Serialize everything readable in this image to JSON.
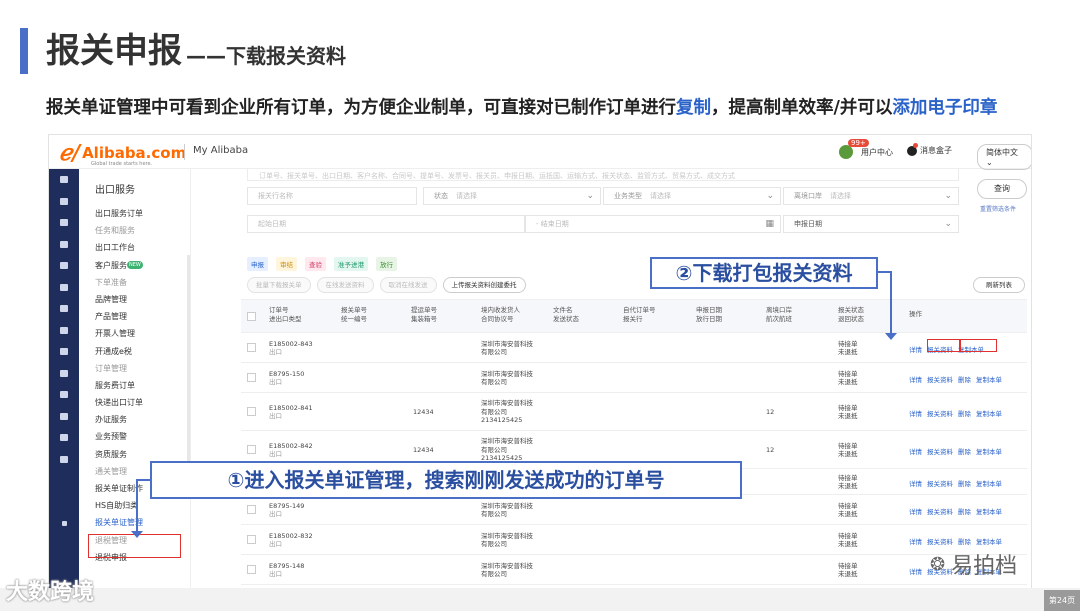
{
  "slide": {
    "title_main": "报关申报",
    "title_sub": "——下载报关资料",
    "subtitle_a": "报关单证管理中可看到企业所有订单，为方便企业制单，可直接对已制作订单进行",
    "subtitle_hl1": "复制",
    "subtitle_b": "，提高制单效率/并可以",
    "subtitle_hl2": "添加电子印章",
    "page_number": "第24页"
  },
  "header": {
    "brand": "Alibaba.com",
    "tagline": "Global trade starts here.",
    "portal": "My Alibaba",
    "user_center": "用户中心",
    "notify_badge": "99+",
    "message_box": "消息盒子",
    "language": "简体中文"
  },
  "sidebar": {
    "title": "出口服务",
    "items": [
      {
        "label": "出口服务订单",
        "kind": "item"
      },
      {
        "label": "任务和服务",
        "kind": "group"
      },
      {
        "label": "出口工作台",
        "kind": "item"
      },
      {
        "label": "客户服务",
        "kind": "item",
        "badge": "NEW"
      },
      {
        "label": "下单准备",
        "kind": "group"
      },
      {
        "label": "品牌管理",
        "kind": "item"
      },
      {
        "label": "产品管理",
        "kind": "item"
      },
      {
        "label": "开票人管理",
        "kind": "item"
      },
      {
        "label": "开通成e税",
        "kind": "item"
      },
      {
        "label": "订单管理",
        "kind": "group"
      },
      {
        "label": "服务费订单",
        "kind": "item"
      },
      {
        "label": "快递出口订单",
        "kind": "item"
      },
      {
        "label": "办证服务",
        "kind": "item"
      },
      {
        "label": "业务预警",
        "kind": "item"
      },
      {
        "label": "资质服务",
        "kind": "item"
      },
      {
        "label": "通关管理",
        "kind": "group"
      },
      {
        "label": "报关单证制作",
        "kind": "item"
      },
      {
        "label": "HS自助归类",
        "kind": "item"
      },
      {
        "label": "报关单证管理",
        "kind": "item",
        "active": true
      },
      {
        "label": "退税管理",
        "kind": "group"
      },
      {
        "label": "退税申报",
        "kind": "item"
      }
    ]
  },
  "filters": {
    "ghost_text": "订单号、报关单号、出口日期、客户名称、合同号、提单号、发票号、报关员、申报日期、运抵国、运输方式、报关状态、监管方式、贸易方式、成交方式",
    "declarant_placeholder": "报关行名称",
    "status_label": "状态",
    "status_value": "请选择",
    "biz_label": "业务类型",
    "biz_value": "请选择",
    "port_label": "离境口岸",
    "port_value": "请选择",
    "start_date": "起始日期",
    "end_date": "结束日期",
    "date_type": "申报日期",
    "query": "查询",
    "reset": "重置筛选条件"
  },
  "status_tags": [
    {
      "label": "申报",
      "bg": "#e5efff",
      "fg": "#2a62c9"
    },
    {
      "label": "审结",
      "bg": "#fff5dd",
      "fg": "#c98a00"
    },
    {
      "label": "查验",
      "bg": "#ffe9ef",
      "fg": "#d0406a"
    },
    {
      "label": "准予进港",
      "bg": "#e3f6f0",
      "fg": "#1f9a6a"
    },
    {
      "label": "放行",
      "bg": "#e8f5e6",
      "fg": "#3a8f2f"
    }
  ],
  "actions": {
    "batch_download": "批量下载报关单",
    "online_send": "在线发送资料",
    "cancel_send": "取消在线发送",
    "upload": "上传报关资料创建委托",
    "refresh": "刷新列表"
  },
  "table": {
    "headers": [
      "订单号\n进出口类型",
      "报关单号\n统一编号",
      "提运单号\n集装箱号",
      "境内收发货人\n合同协议号",
      "文件名\n发送状态",
      "自代订单号\n报关行",
      "申报日期\n放行日期",
      "离境口岸\n航次航班",
      "报关状态\n退回状态",
      "操作"
    ],
    "rows": [
      {
        "order": "E185002-843",
        "type": "出口",
        "bl": "",
        "company": "深圳市海安普科技\n有限公司",
        "port": "",
        "status": "待接单\n未退抵",
        "ops": [
          "详情",
          "报关资料",
          "复制本单"
        ]
      },
      {
        "order": "E8795-150",
        "type": "出口",
        "bl": "",
        "company": "深圳市海安普科技\n有限公司",
        "port": "",
        "status": "待接单\n未退抵",
        "ops": [
          "详情",
          "报关资料",
          "删除",
          "复制本单"
        ]
      },
      {
        "order": "E185002-841",
        "type": "出口",
        "bl": "12434",
        "company": "深圳市海安普科技\n有限公司\n2134125425",
        "port": "12",
        "status": "待接单\n未退抵",
        "ops": [
          "详情",
          "报关资料",
          "删除",
          "复制本单"
        ]
      },
      {
        "order": "E185002-842",
        "type": "出口",
        "bl": "12434",
        "company": "深圳市海安普科技\n有限公司\n2134125425",
        "port": "12",
        "status": "待接单\n未退抵",
        "ops": [
          "详情",
          "报关资料",
          "删除",
          "复制本单"
        ]
      },
      {
        "order": "",
        "type": "",
        "bl": "",
        "company": "",
        "port": "",
        "status": "待接单\n未退抵",
        "ops": [
          "详情",
          "报关资料",
          "删除",
          "复制本单"
        ]
      },
      {
        "order": "E8795-149",
        "type": "出口",
        "bl": "",
        "company": "深圳市海安普科技\n有限公司",
        "port": "",
        "status": "待接单\n未退抵",
        "ops": [
          "详情",
          "报关资料",
          "删除",
          "复制本单"
        ]
      },
      {
        "order": "E185002-832",
        "type": "出口",
        "bl": "",
        "company": "深圳市海安普科技\n有限公司",
        "port": "",
        "status": "待接单\n未退抵",
        "ops": [
          "详情",
          "报关资料",
          "删除",
          "复制本单"
        ]
      },
      {
        "order": "E8795-148",
        "type": "出口",
        "bl": "",
        "company": "深圳市海安普科技\n有限公司",
        "port": "",
        "status": "待接单\n未退抵",
        "ops": [
          "详情",
          "报关资料",
          "删除",
          "复制本单"
        ]
      }
    ]
  },
  "callouts": {
    "step1": "①进入报关单证管理，搜索刚刚发送成功的订单号",
    "step2": "②下载打包报关资料"
  },
  "watermarks": {
    "left": "大数跨境",
    "right": "易拍档"
  }
}
